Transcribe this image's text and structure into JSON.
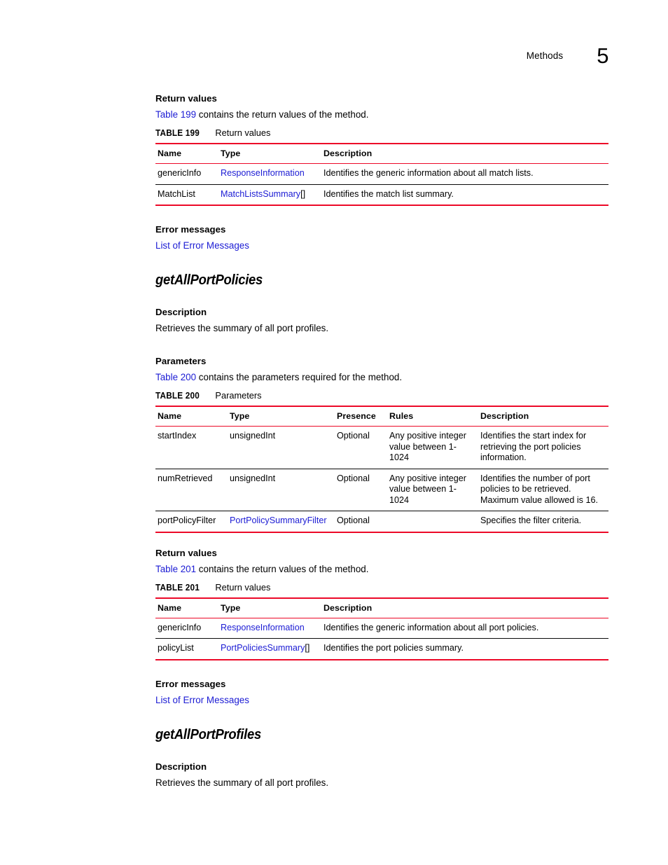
{
  "header": {
    "title": "Methods",
    "chapter": "5"
  },
  "sections": {
    "return_values_1": {
      "heading": "Return values",
      "lead_link": "Table 199",
      "lead_rest": " contains the return values of the method."
    },
    "error_messages_1": {
      "heading": "Error messages",
      "link": "List of Error Messages"
    },
    "method_1": {
      "name": "getAllPortPolicies",
      "description_heading": "Description",
      "description_text": "Retrieves the summary of all port profiles.",
      "parameters_heading": "Parameters",
      "parameters_lead_link": "Table 200",
      "parameters_lead_rest": " contains the parameters required for the method."
    },
    "return_values_2": {
      "heading": "Return values",
      "lead_link": "Table 201",
      "lead_rest": " contains the return values of the method."
    },
    "error_messages_2": {
      "heading": "Error messages",
      "link": "List of Error Messages"
    },
    "method_2": {
      "name": "getAllPortProfiles",
      "description_heading": "Description",
      "description_text": "Retrieves the summary of all port profiles."
    }
  },
  "tables": {
    "t199": {
      "number": "TABLE 199",
      "title": "Return values",
      "columns": [
        "Name",
        "Type",
        "Description"
      ],
      "rows": [
        {
          "name": "genericInfo",
          "type": "ResponseInformation",
          "type_suffix": "",
          "type_is_link": true,
          "description": "Identifies the generic information about all match lists."
        },
        {
          "name": "MatchList",
          "type": "MatchListsSummary",
          "type_suffix": "[]",
          "type_is_link": true,
          "description": "Identifies the match list summary."
        }
      ]
    },
    "t200": {
      "number": "TABLE 200",
      "title": "Parameters",
      "columns": [
        "Name",
        "Type",
        "Presence",
        "Rules",
        "Description"
      ],
      "rows": [
        {
          "name": "startIndex",
          "type": "unsignedInt",
          "type_suffix": "",
          "type_is_link": false,
          "presence": "Optional",
          "rules": "Any positive integer value between 1-1024",
          "description": "Identifies the start index for retrieving the port policies information."
        },
        {
          "name": "numRetrieved",
          "type": "unsignedInt",
          "type_suffix": "",
          "type_is_link": false,
          "presence": "Optional",
          "rules": "Any positive integer value between 1-1024",
          "description": "Identifies the number of port policies to be retrieved. Maximum value allowed is 16."
        },
        {
          "name": "portPolicyFilter",
          "type": "PortPolicySummaryFilter",
          "type_suffix": "",
          "type_is_link": true,
          "presence": "Optional",
          "rules": "",
          "description": "Specifies the filter criteria."
        }
      ]
    },
    "t201": {
      "number": "TABLE 201",
      "title": "Return values",
      "columns": [
        "Name",
        "Type",
        "Description"
      ],
      "rows": [
        {
          "name": "genericInfo",
          "type": "ResponseInformation",
          "type_suffix": "",
          "type_is_link": true,
          "description": "Identifies the generic information about all port policies."
        },
        {
          "name": "policyList",
          "type": "PortPoliciesSummary",
          "type_suffix": "[]",
          "type_is_link": true,
          "description": "Identifies the port policies summary."
        }
      ]
    }
  },
  "colors": {
    "rule_red": "#ec0928",
    "link_blue": "#1b1bd4",
    "text_black": "#000000"
  }
}
